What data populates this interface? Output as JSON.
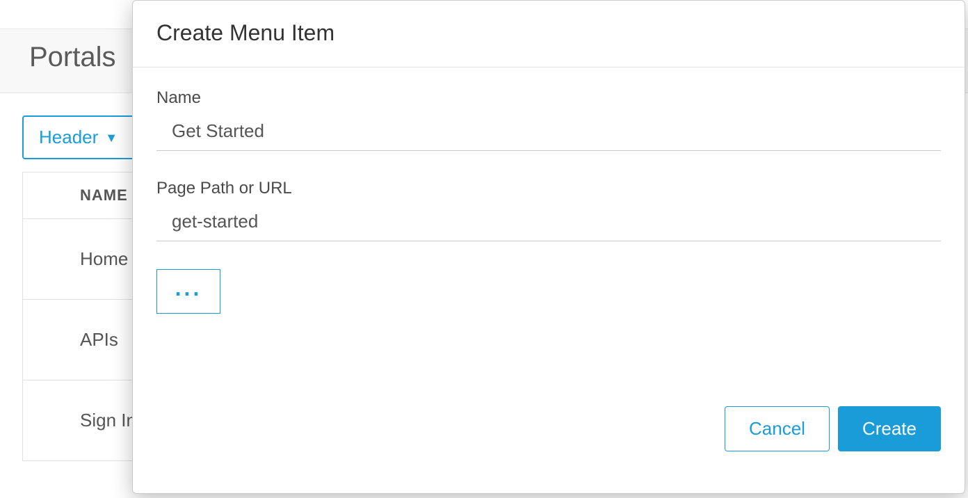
{
  "page": {
    "title": "Portals"
  },
  "toolbar": {
    "dropdown_label": "Header",
    "dropdown_caret": "▼"
  },
  "table": {
    "header": "NAME",
    "rows": [
      "Home",
      "APIs",
      "Sign In"
    ]
  },
  "modal": {
    "title": "Create Menu Item",
    "name_label": "Name",
    "name_value": "Get Started",
    "path_label": "Page Path or URL",
    "path_value": "get-started",
    "more_label": "...",
    "cancel_label": "Cancel",
    "create_label": "Create"
  }
}
